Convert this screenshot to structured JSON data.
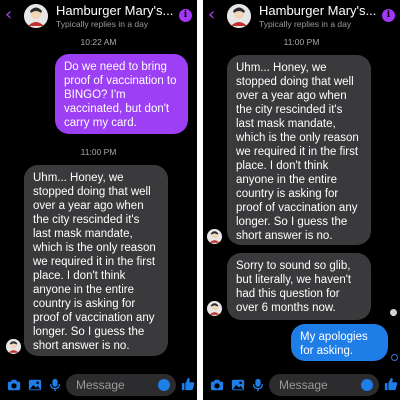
{
  "colors": {
    "accent_purple": "#9c3ff5",
    "accent_blue": "#1f7de8",
    "received_bubble": "#3a3a3c",
    "background": "#000000"
  },
  "left_pane": {
    "header": {
      "title": "Hamburger Mary's...",
      "subtitle": "Typically replies in a day",
      "back_icon": "chevron-left-icon",
      "info_icon": "info-icon"
    },
    "timestamp_1": "10:22 AM",
    "sent_message": "Do we need to bring proof of vaccination to BINGO? I'm vaccinated, but don't carry my card.",
    "timestamp_2": "11:00 PM",
    "reply_message": "Uhm... Honey, we stopped doing that well over a year ago when the city rescinded it's last mask mandate, which is the only reason we required it in the first place. I don't think anyone in the entire country is asking for proof of vaccination any longer. So I guess the short answer is no.",
    "composer": {
      "placeholder": "Message",
      "icons": [
        "camera-icon",
        "image-icon",
        "microphone-icon",
        "emoji-icon",
        "thumbs-up-icon"
      ]
    }
  },
  "right_pane": {
    "header": {
      "title": "Hamburger Mary's...",
      "subtitle": "Typically replies in a day",
      "back_icon": "chevron-left-icon",
      "info_icon": "info-icon"
    },
    "timestamp": "11:00 PM",
    "reply_message": "Uhm... Honey, we stopped doing that well over a year ago when the city rescinded it's last mask mandate, which is the only reason we required it in the first place. I don't think anyone in the entire country is asking for proof of vaccination any longer. So I guess the short answer is no.",
    "followup_message": "Sorry to sound so glib, but literally, we haven't had this question for over 6 months now.",
    "sent_message": "My apologies for asking.",
    "composer": {
      "placeholder": "Message",
      "icons": [
        "camera-icon",
        "image-icon",
        "microphone-icon",
        "emoji-icon",
        "thumbs-up-icon"
      ]
    }
  }
}
